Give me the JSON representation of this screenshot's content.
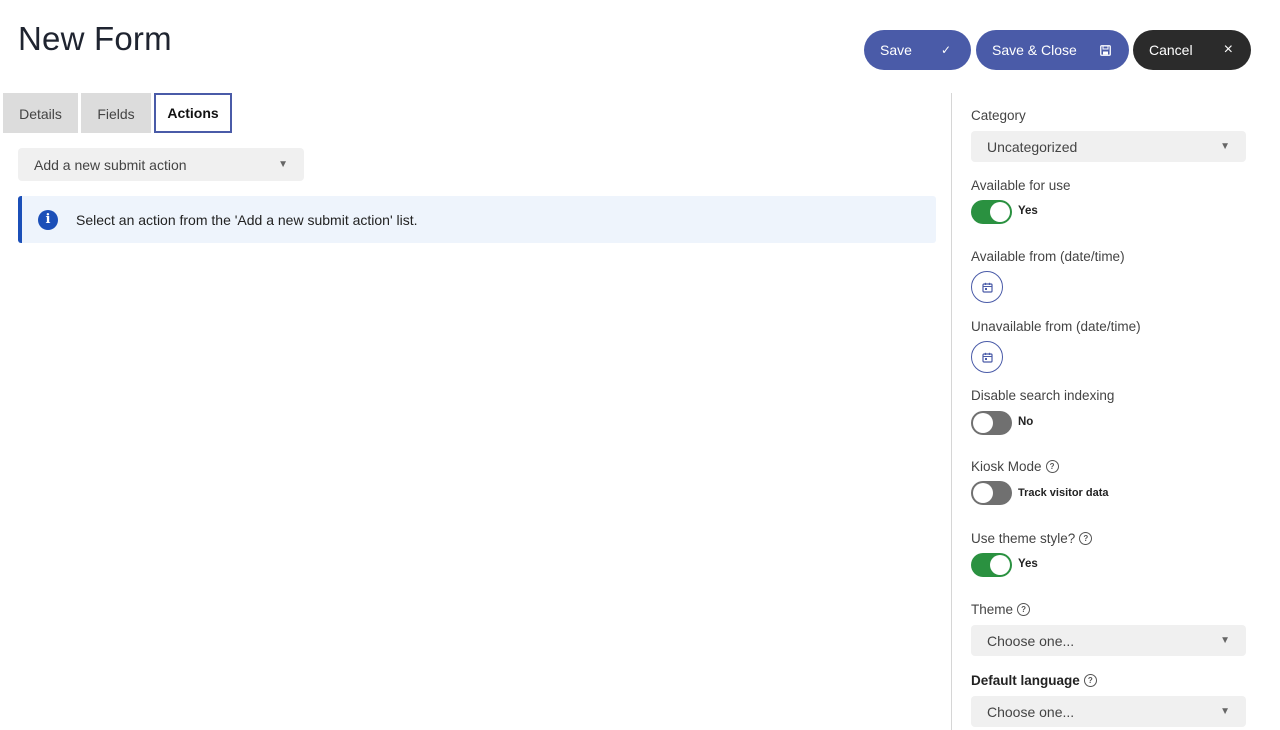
{
  "page": {
    "title": "New Form"
  },
  "toolbar": {
    "save_label": "Save",
    "save_close_label": "Save & Close",
    "cancel_label": "Cancel",
    "cancel_icon": "×",
    "save_icon": "✓"
  },
  "tabs": [
    {
      "label": "Details",
      "active": false
    },
    {
      "label": "Fields",
      "active": false
    },
    {
      "label": "Actions",
      "active": true
    }
  ],
  "actions": {
    "submit_action_select": "Add a new submit action",
    "alert_message": "Select an action from the 'Add a new submit action' list."
  },
  "sidebar": {
    "category": {
      "label": "Category",
      "value": "Uncategorized"
    },
    "available_for_use": {
      "label": "Available for use",
      "value": "Yes",
      "on": true
    },
    "available_from": {
      "label": "Available from (date/time)"
    },
    "unavailable_from": {
      "label": "Unavailable from (date/time)"
    },
    "disable_search_indexing": {
      "label": "Disable search indexing",
      "value": "No",
      "on": false
    },
    "kiosk_mode": {
      "label": "Kiosk Mode",
      "value": "Track visitor data",
      "on": false
    },
    "use_theme_style": {
      "label": "Use theme style?",
      "value": "Yes",
      "on": true
    },
    "theme": {
      "label": "Theme",
      "value": "Choose one..."
    },
    "default_language": {
      "label": "Default language",
      "value": "Choose one..."
    },
    "help_glyph": "?"
  },
  "colors": {
    "accent": "#4a5ba8",
    "toggle_on": "#2a9140",
    "info": "#1b4fb8",
    "cancel": "#2b2b2b"
  }
}
